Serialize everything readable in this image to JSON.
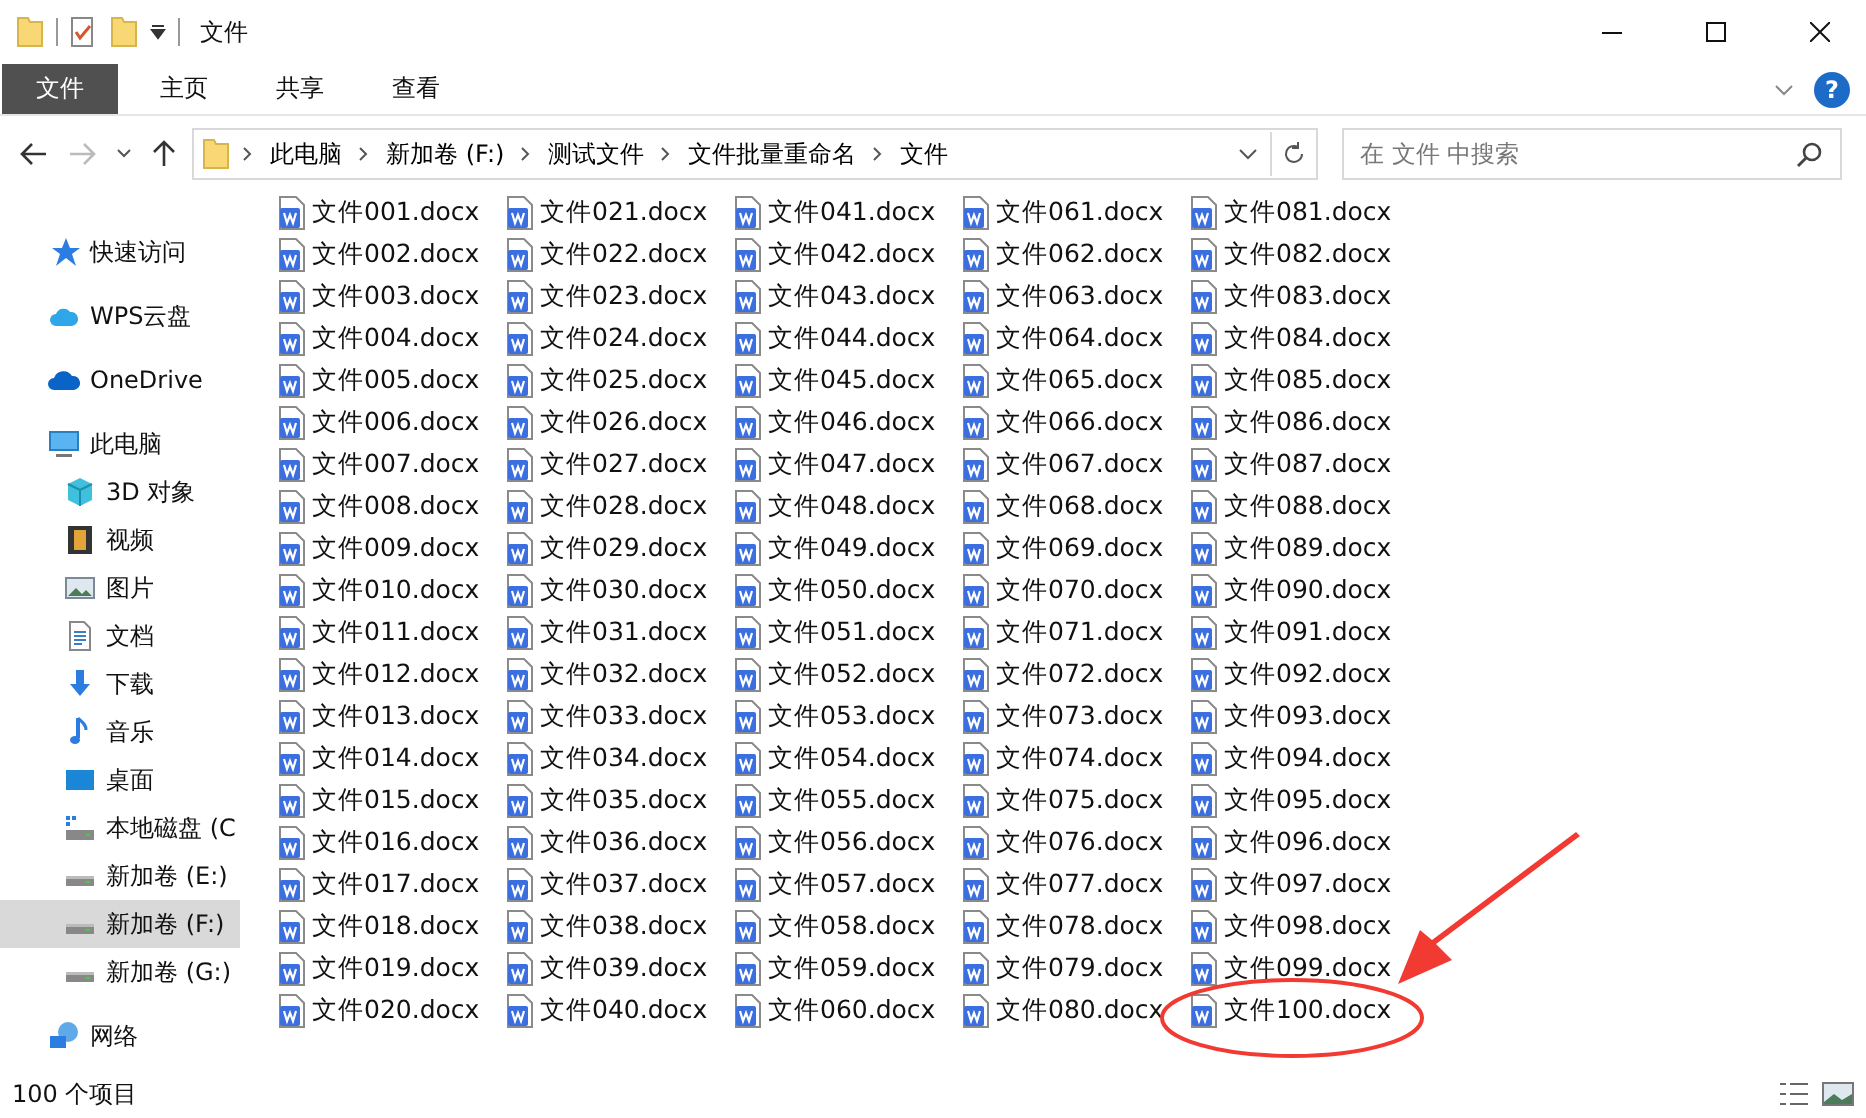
{
  "window": {
    "title": "文件"
  },
  "ribbon": {
    "tabs": [
      {
        "label": "文件",
        "kind": "menu"
      },
      {
        "label": "主页",
        "kind": "tab"
      },
      {
        "label": "共享",
        "kind": "tab"
      },
      {
        "label": "查看",
        "kind": "tab"
      }
    ],
    "help": "?"
  },
  "address": {
    "path": [
      "此电脑",
      "新加卷 (F:)",
      "测试文件",
      "文件批量重命名",
      "文件"
    ]
  },
  "search": {
    "placeholder": "在 文件 中搜索"
  },
  "sidebar": {
    "items": [
      {
        "label": "快速访问",
        "kind": "star",
        "selected": false
      },
      {
        "label": "WPS云盘",
        "kind": "cloud",
        "selected": false
      },
      {
        "label": "OneDrive",
        "kind": "onedrive",
        "selected": false
      },
      {
        "label": "此电脑",
        "kind": "pc",
        "selected": false,
        "children": [
          {
            "label": "3D 对象",
            "kind": "cube",
            "selected": false
          },
          {
            "label": "视频",
            "kind": "film",
            "selected": false
          },
          {
            "label": "图片",
            "kind": "picture",
            "selected": false
          },
          {
            "label": "文档",
            "kind": "document",
            "selected": false
          },
          {
            "label": "下载",
            "kind": "download",
            "selected": false
          },
          {
            "label": "音乐",
            "kind": "music",
            "selected": false
          },
          {
            "label": "桌面",
            "kind": "desktop",
            "selected": false
          },
          {
            "label": "本地磁盘 (C",
            "kind": "system-drive",
            "selected": false
          },
          {
            "label": "新加卷 (E:)",
            "kind": "drive",
            "selected": false
          },
          {
            "label": "新加卷 (F:)",
            "kind": "drive",
            "selected": true
          },
          {
            "label": "新加卷 (G:)",
            "kind": "drive",
            "selected": false
          }
        ]
      },
      {
        "label": "网络",
        "kind": "network",
        "selected": false
      }
    ]
  },
  "files": [
    [
      "文件001.docx",
      "文件002.docx",
      "文件003.docx",
      "文件004.docx",
      "文件005.docx",
      "文件006.docx",
      "文件007.docx",
      "文件008.docx",
      "文件009.docx",
      "文件010.docx",
      "文件011.docx",
      "文件012.docx",
      "文件013.docx",
      "文件014.docx",
      "文件015.docx",
      "文件016.docx",
      "文件017.docx",
      "文件018.docx",
      "文件019.docx",
      "文件020.docx"
    ],
    [
      "文件021.docx",
      "文件022.docx",
      "文件023.docx",
      "文件024.docx",
      "文件025.docx",
      "文件026.docx",
      "文件027.docx",
      "文件028.docx",
      "文件029.docx",
      "文件030.docx",
      "文件031.docx",
      "文件032.docx",
      "文件033.docx",
      "文件034.docx",
      "文件035.docx",
      "文件036.docx",
      "文件037.docx",
      "文件038.docx",
      "文件039.docx",
      "文件040.docx"
    ],
    [
      "文件041.docx",
      "文件042.docx",
      "文件043.docx",
      "文件044.docx",
      "文件045.docx",
      "文件046.docx",
      "文件047.docx",
      "文件048.docx",
      "文件049.docx",
      "文件050.docx",
      "文件051.docx",
      "文件052.docx",
      "文件053.docx",
      "文件054.docx",
      "文件055.docx",
      "文件056.docx",
      "文件057.docx",
      "文件058.docx",
      "文件059.docx",
      "文件060.docx"
    ],
    [
      "文件061.docx",
      "文件062.docx",
      "文件063.docx",
      "文件064.docx",
      "文件065.docx",
      "文件066.docx",
      "文件067.docx",
      "文件068.docx",
      "文件069.docx",
      "文件070.docx",
      "文件071.docx",
      "文件072.docx",
      "文件073.docx",
      "文件074.docx",
      "文件075.docx",
      "文件076.docx",
      "文件077.docx",
      "文件078.docx",
      "文件079.docx",
      "文件080.docx"
    ],
    [
      "文件081.docx",
      "文件082.docx",
      "文件083.docx",
      "文件084.docx",
      "文件085.docx",
      "文件086.docx",
      "文件087.docx",
      "文件088.docx",
      "文件089.docx",
      "文件090.docx",
      "文件091.docx",
      "文件092.docx",
      "文件093.docx",
      "文件094.docx",
      "文件095.docx",
      "文件096.docx",
      "文件097.docx",
      "文件098.docx",
      "文件099.docx",
      "文件100.docx"
    ]
  ],
  "status_bar": {
    "count": "100 个项目"
  }
}
